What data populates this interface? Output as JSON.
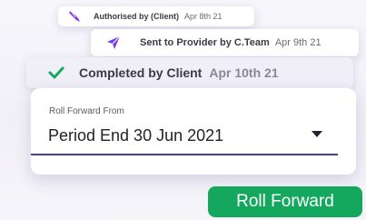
{
  "timeline": {
    "authorised": {
      "label": "Authorised by (Client)",
      "date": "Apr 8th 21",
      "icon": "feather-pen-icon"
    },
    "sent": {
      "label": "Sent to Provider by C.Team",
      "date": "Apr 9th 21",
      "icon": "paper-plane-icon"
    },
    "completed": {
      "label": "Completed by Client",
      "date": "Apr 10th 21",
      "icon": "checkmark-icon"
    }
  },
  "form": {
    "field_label": "Roll Forward From",
    "selected_value": "Period End 30 Jun 2021"
  },
  "actions": {
    "roll_forward_label": "Roll Forward"
  },
  "colors": {
    "accent_purple": "#7a3cf0",
    "accent_green": "#14a85e",
    "underline": "#4b3c94"
  }
}
